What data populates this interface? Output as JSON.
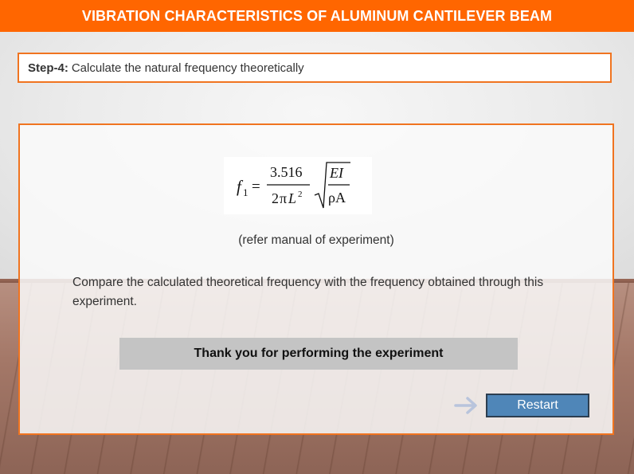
{
  "header": {
    "title": "VIBRATION CHARACTERISTICS OF ALUMINUM CANTILEVER BEAM"
  },
  "step": {
    "label": "Step-4:",
    "text": "Calculate the natural frequency theoretically"
  },
  "panel": {
    "formula": {
      "lhs": "f",
      "lhs_subscript": "1",
      "equals": "=",
      "numerator": "3.516",
      "denominator_coef": "2",
      "denominator_pi": "π",
      "denominator_var": "L",
      "denominator_exp": "2",
      "root_numerator": "EI",
      "root_denominator": "ρA"
    },
    "refer_text": "(refer manual of experiment)",
    "compare_text": "Compare the calculated theoretical frequency with the frequency obtained through this experiment.",
    "thanks_text": "Thank you for performing the experiment",
    "restart_label": "Restart"
  },
  "colors": {
    "accent": "#ff6600",
    "border": "#f07420",
    "button": "#4f86b8",
    "arrow": "#b8c4dc"
  },
  "icons": {
    "arrow": "arrow-right-icon"
  }
}
